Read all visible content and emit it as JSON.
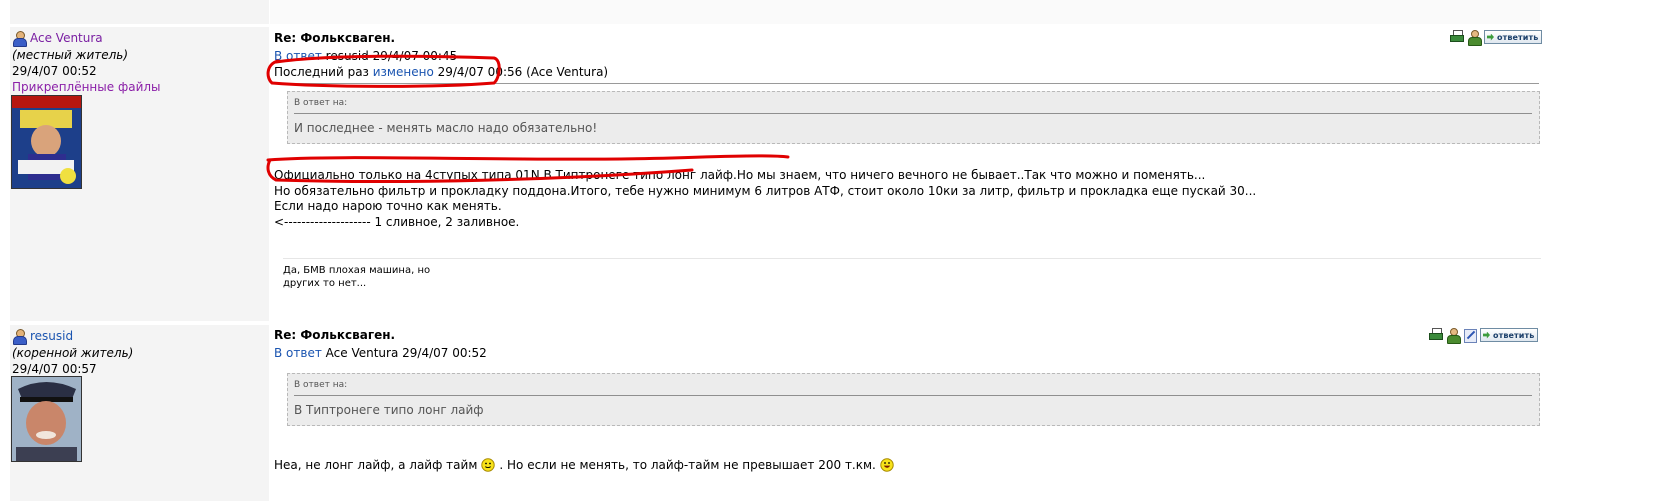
{
  "posts": [
    {
      "author": "Ace Ventura",
      "status": "(местный житель)",
      "date": "29/4/07 00:52",
      "attachments_label": "Прикреплённые файлы",
      "title": "Re: Фольксваген.",
      "reply_link": "В ответ",
      "reply_to": "resusid 29/4/07 00:45",
      "edited_prefix": "Последний раз",
      "edited_link": "изменено",
      "edited_info": "29/4/07 00:56 (Ace Ventura)",
      "quote_label": "В ответ на:",
      "quote_text": "И последнее - менять масло надо обязательно!",
      "body_lines": [
        "Официально только на 4ступых типа 01N.В Типтронеге типо лонг лайф.Но мы знаем, что ничего вечного не бывает..Так что можно и поменять...",
        "Но обязательно фильтр и прокладку поддона.Итого, тебе нужно минимум 6 литров АТФ, стоит около 10ки за литр, фильтр и прокладка еще пускай 30...",
        "Если надо нарою точно как менять.",
        "<-------------------- 1 сливное, 2 заливное."
      ],
      "signature": "Да, БМВ плохая машина, но других то нет...",
      "reply_button": "ответить"
    },
    {
      "author": "resusid",
      "status": "(коренной житель)",
      "date": "29/4/07 00:57",
      "title": "Re: Фольксваген.",
      "reply_link": "В ответ",
      "reply_to": "Ace Ventura 29/4/07 00:52",
      "quote_label": "В ответ на:",
      "quote_text": "В Типтронеге типо лонг лайф",
      "body_parts": [
        "Неа, не лонг лайф, а лайф тайм",
        ". Но если не менять, то лайф-тайм не превышает 200 т.км."
      ],
      "reply_button": "ответить"
    }
  ],
  "colors": {
    "sidebar_bg": "#f4f4f4",
    "link": "#1a54b0",
    "author_link": "#7a1fa2",
    "annotation_red": "#e00000",
    "quote_bg": "#ececec"
  },
  "icons": [
    "user-icon",
    "printer-icon",
    "private-message-icon",
    "edit-icon",
    "reply-arrow-icon",
    "smiley-icon"
  ]
}
